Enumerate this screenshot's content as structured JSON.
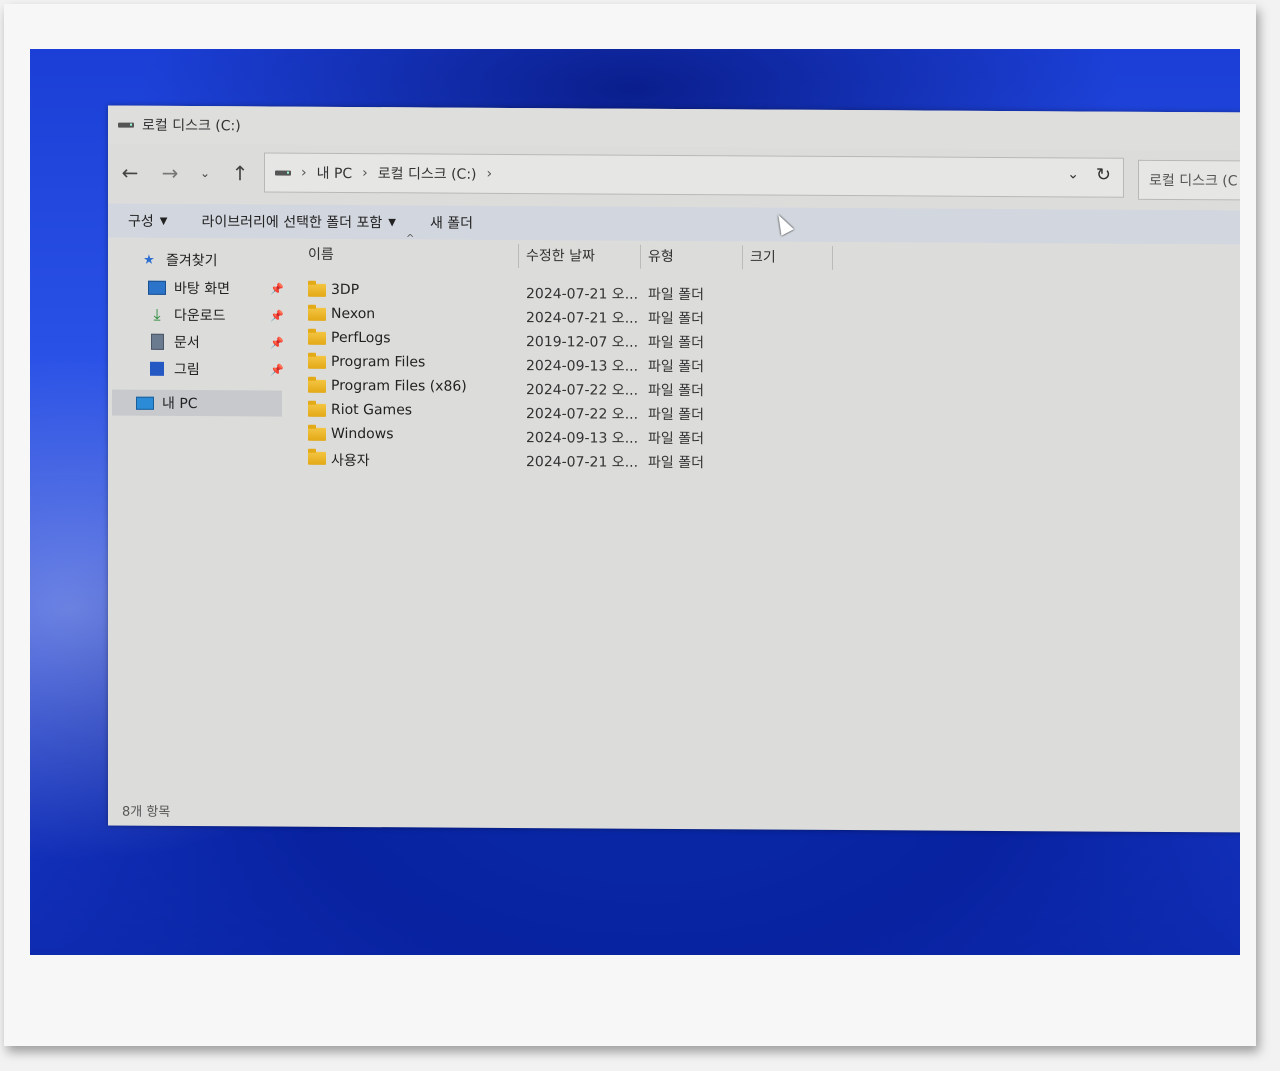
{
  "window": {
    "title": "로컬 디스크 (C:)"
  },
  "nav": {
    "back_icon": "←",
    "forward_icon": "→",
    "recent_icon": "⌄",
    "up_icon": "↑"
  },
  "address": {
    "segments": [
      "내 PC",
      "로컬 디스크 (C:)"
    ],
    "separator": "›",
    "dropdown_icon": "⌄",
    "refresh_icon": "↻"
  },
  "search": {
    "placeholder": "로컬 디스크 (C"
  },
  "toolbar": {
    "organize": "구성",
    "include_in_library": "라이브러리에 선택한 폴더 포함",
    "new_folder": "새 폴더",
    "caret": "▼"
  },
  "sidebar": {
    "quick_access": "즐겨찾기",
    "items": [
      {
        "label": "바탕 화면",
        "icon": "desktop-icon"
      },
      {
        "label": "다운로드",
        "icon": "download-icon"
      },
      {
        "label": "문서",
        "icon": "document-icon"
      },
      {
        "label": "그림",
        "icon": "pictures-icon"
      }
    ],
    "this_pc": "내 PC"
  },
  "columns": {
    "name": "이름",
    "date": "수정한 날짜",
    "type": "유형",
    "size": "크기"
  },
  "files": [
    {
      "name": "3DP",
      "date": "2024-07-21 오...",
      "type": "파일 폴더"
    },
    {
      "name": "Nexon",
      "date": "2024-07-21 오...",
      "type": "파일 폴더"
    },
    {
      "name": "PerfLogs",
      "date": "2019-12-07 오...",
      "type": "파일 폴더"
    },
    {
      "name": "Program Files",
      "date": "2024-09-13 오...",
      "type": "파일 폴더"
    },
    {
      "name": "Program Files (x86)",
      "date": "2024-07-22 오...",
      "type": "파일 폴더"
    },
    {
      "name": "Riot Games",
      "date": "2024-07-22 오...",
      "type": "파일 폴더"
    },
    {
      "name": "Windows",
      "date": "2024-09-13 오...",
      "type": "파일 폴더"
    },
    {
      "name": "사용자",
      "date": "2024-07-21 오...",
      "type": "파일 폴더"
    }
  ],
  "status": {
    "item_count": "8개 항목"
  }
}
